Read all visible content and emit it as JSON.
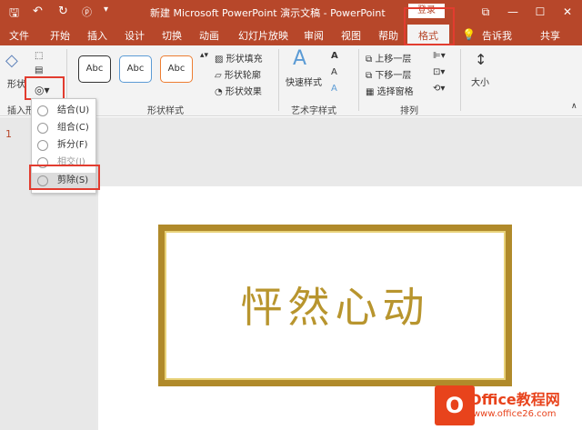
{
  "title": "新建 Microsoft PowerPoint 演示文稿 - PowerPoint",
  "login": "登录",
  "window_buttons": {
    "restore": "⧉",
    "minimize": "—",
    "maximize": "☐",
    "close": "✕"
  },
  "tabs": [
    "文件",
    "开始",
    "插入",
    "设计",
    "切换",
    "动画",
    "幻灯片放映",
    "审阅",
    "视图",
    "帮助",
    "格式",
    "告诉我",
    "共享"
  ],
  "ribbon": {
    "shape_styles": {
      "abc": [
        "Abc",
        "Abc",
        "Abc"
      ],
      "fill": "形状填充",
      "outline": "形状轮廓",
      "effect": "形状效果",
      "label": "形状样式"
    },
    "insert_shapes_label": "插入形",
    "shapes_label_top": "形状",
    "art": {
      "quick": "快速样式",
      "label": "艺术字样式"
    },
    "arrange": {
      "up": "上移一层",
      "down": "下移一层",
      "pane": "选择窗格",
      "label": "排列"
    },
    "size": {
      "label": "大小"
    }
  },
  "menu": {
    "items": [
      "结合(U)",
      "组合(C)",
      "拆分(F)",
      "相交(I)",
      "剪除(S)"
    ]
  },
  "slide": {
    "num": "1",
    "text": "怦然心动"
  },
  "watermark": {
    "logo": "O",
    "name": "Office教程网",
    "url": "www.office26.com"
  },
  "colors": {
    "accent": "#b7472a",
    "red": "#e23c2f",
    "gold": "#b8952e"
  }
}
